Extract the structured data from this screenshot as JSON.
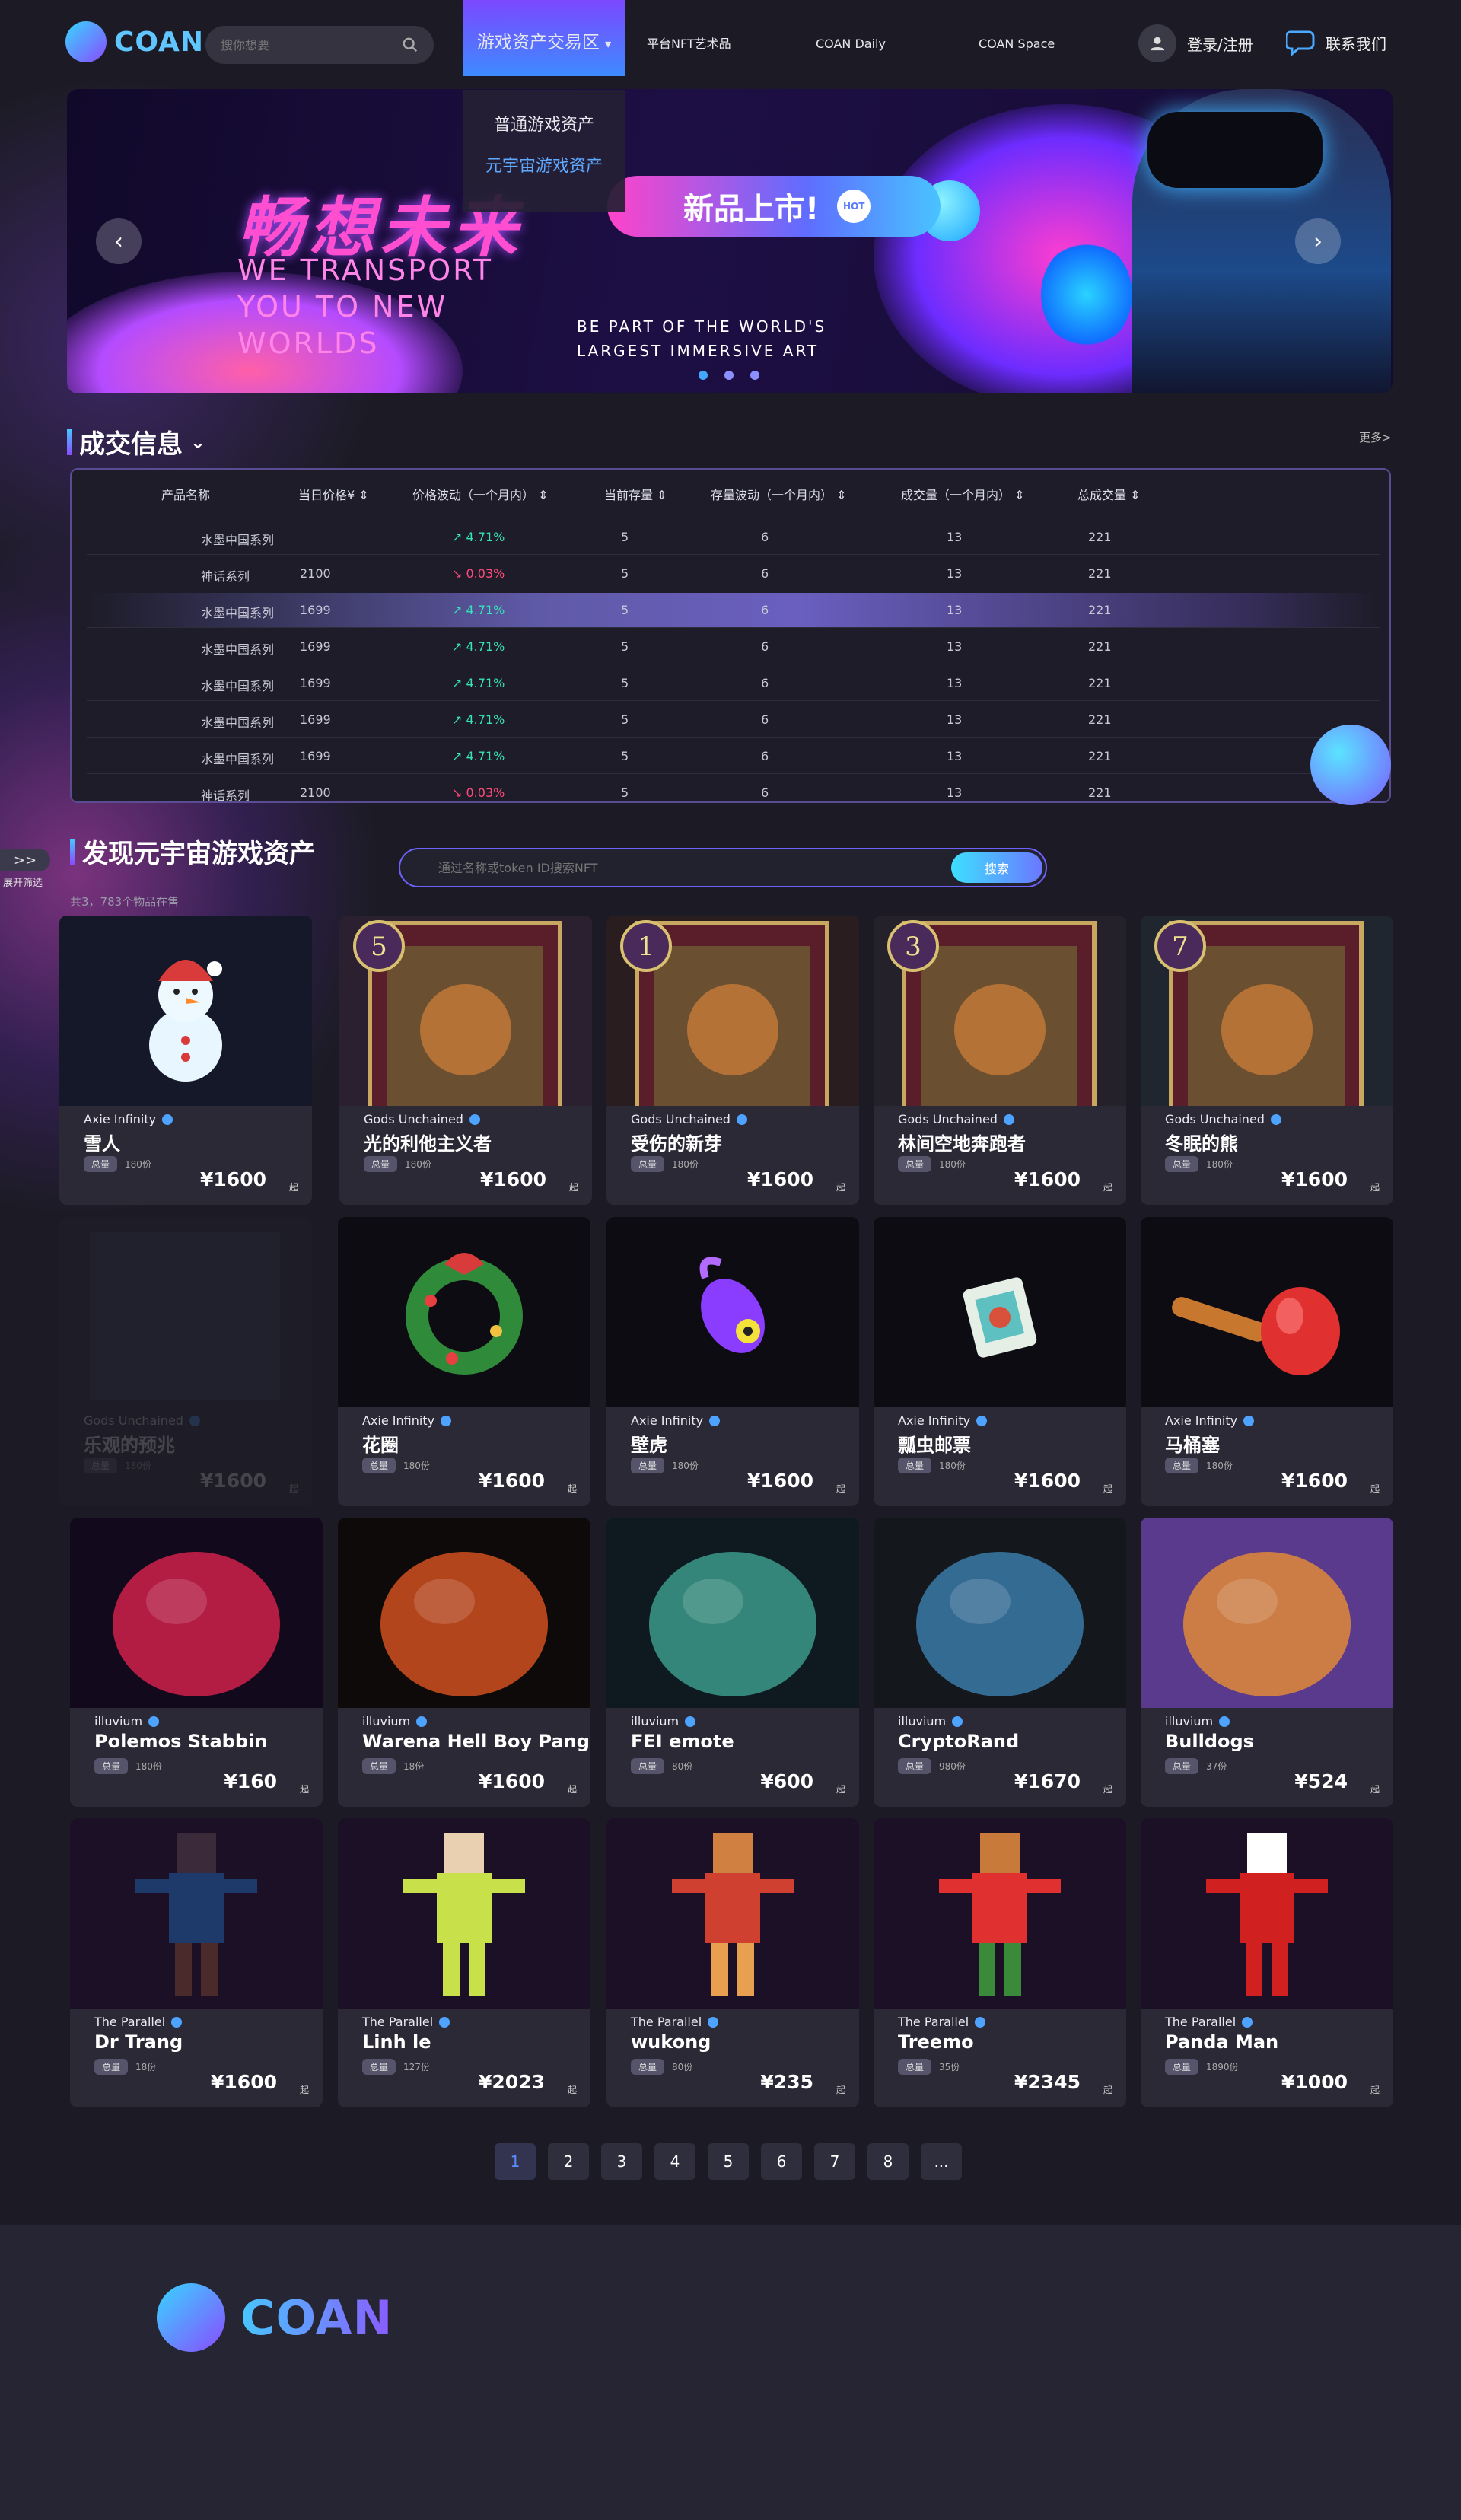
{
  "header": {
    "logo_text": "COAN",
    "search_placeholder": "搜你想要",
    "nav": [
      "游戏资产交易区",
      "平台NFT艺术品",
      "COAN Daily",
      "COAN Space"
    ],
    "dropdown": [
      "普通游戏资产",
      "元宇宙游戏资产"
    ],
    "login_label": "登录/注册",
    "contact_label": "联系我们"
  },
  "banner": {
    "title": "畅想未来",
    "pill": "新品上市!",
    "hot": "HOT",
    "en_lines": [
      "WE TRANSPORT",
      "YOU TO NEW",
      "WORLDS"
    ],
    "sub_lines": [
      "BE PART OF THE WORLD'S",
      "LARGEST IMMERSIVE ART"
    ]
  },
  "trade": {
    "title": "成交信息",
    "more": "更多>",
    "columns": [
      "产品名称",
      "当日价格¥",
      "价格波动（一个月内）",
      "当前存量",
      "存量波动（一个月内）",
      "成交量（一个月内）",
      "总成交量"
    ],
    "rows": [
      {
        "name": "水墨中国系列",
        "price": "",
        "change": "4.71%",
        "dir": "up",
        "stock": "5",
        "stock_change": "6",
        "volume": "13",
        "total": "221"
      },
      {
        "name": "神话系列",
        "price": "2100",
        "change": "0.03%",
        "dir": "down",
        "stock": "5",
        "stock_change": "6",
        "volume": "13",
        "total": "221"
      },
      {
        "name": "水墨中国系列",
        "price": "1699",
        "change": "4.71%",
        "dir": "up",
        "stock": "5",
        "stock_change": "6",
        "volume": "13",
        "total": "221"
      },
      {
        "name": "水墨中国系列",
        "price": "1699",
        "change": "4.71%",
        "dir": "up",
        "stock": "5",
        "stock_change": "6",
        "volume": "13",
        "total": "221"
      },
      {
        "name": "水墨中国系列",
        "price": "1699",
        "change": "4.71%",
        "dir": "up",
        "stock": "5",
        "stock_change": "6",
        "volume": "13",
        "total": "221"
      },
      {
        "name": "水墨中国系列",
        "price": "1699",
        "change": "4.71%",
        "dir": "up",
        "stock": "5",
        "stock_change": "6",
        "volume": "13",
        "total": "221"
      },
      {
        "name": "水墨中国系列",
        "price": "1699",
        "change": "4.71%",
        "dir": "up",
        "stock": "5",
        "stock_change": "6",
        "volume": "13",
        "total": "221"
      },
      {
        "name": "神话系列",
        "price": "2100",
        "change": "0.03%",
        "dir": "down",
        "stock": "5",
        "stock_change": "6",
        "volume": "13",
        "total": "221"
      }
    ]
  },
  "side_filter": {
    "label": "展开筛选",
    "icon": ">>"
  },
  "discover": {
    "title": "发现元宇宙游戏资产",
    "count": "共3，783个物品在售",
    "search_placeholder": "通过名称或token ID搜索NFT",
    "search_button": "搜索"
  },
  "cards": [
    {
      "brand": "Axie Infinity",
      "name": "雪人",
      "tag": "总量",
      "qty": "180份",
      "price": "¥1600",
      "suffix": "起",
      "bg": "#151829",
      "art": "snowman"
    },
    {
      "brand": "Gods Unchained",
      "name": "光的利他主义者",
      "tag": "总量",
      "qty": "180份",
      "price": "¥1600",
      "suffix": "起",
      "bg": "#2b2030",
      "art": "card5"
    },
    {
      "brand": "Gods Unchained",
      "name": "受伤的新芽",
      "tag": "总量",
      "qty": "180份",
      "price": "¥1600",
      "suffix": "起",
      "bg": "#2a1d20",
      "art": "card1"
    },
    {
      "brand": "Gods Unchained",
      "name": "林间空地奔跑者",
      "tag": "总量",
      "qty": "180份",
      "price": "¥1600",
      "suffix": "起",
      "bg": "#24212a",
      "art": "card3"
    },
    {
      "brand": "Gods Unchained",
      "name": "冬眠的熊",
      "tag": "总量",
      "qty": "180份",
      "price": "¥1600",
      "suffix": "起",
      "bg": "#1f2630",
      "art": "card7"
    },
    {
      "brand": "Gods Unchained",
      "name": "乐观的预兆",
      "tag": "总量",
      "qty": "180份",
      "price": "¥1600",
      "suffix": "起",
      "bg": "#2a2935",
      "art": "faded"
    },
    {
      "brand": "Axie Infinity",
      "name": "花圈",
      "tag": "总量",
      "qty": "180份",
      "price": "¥1600",
      "suffix": "起",
      "bg": "#0d0c12",
      "art": "wreath"
    },
    {
      "brand": "Axie Infinity",
      "name": "壁虎",
      "tag": "总量",
      "qty": "180份",
      "price": "¥1600",
      "suffix": "起",
      "bg": "#0d0c12",
      "art": "gecko"
    },
    {
      "brand": "Axie Infinity",
      "name": "瓢虫邮票",
      "tag": "总量",
      "qty": "180份",
      "price": "¥1600",
      "suffix": "起",
      "bg": "#0d0c12",
      "art": "stamp"
    },
    {
      "brand": "Axie Infinity",
      "name": "马桶塞",
      "tag": "总量",
      "qty": "180份",
      "price": "¥1600",
      "suffix": "起",
      "bg": "#0d0c12",
      "art": "plunger"
    },
    {
      "brand": "illuvium",
      "name": "Polemos Stabbin",
      "tag": "总量",
      "qty": "180份",
      "price": "¥160",
      "suffix": "起",
      "bg": "#120a1c",
      "art": "red"
    },
    {
      "brand": "illuvium",
      "name": "Warena Hell Boy Pangolin",
      "tag": "总量",
      "qty": "18份",
      "price": "¥1600",
      "suffix": "起",
      "bg": "#0e0a0a",
      "art": "fire"
    },
    {
      "brand": "illuvium",
      "name": "FEI emote",
      "tag": "总量",
      "qty": "80份",
      "price": "¥600",
      "suffix": "起",
      "bg": "#0f1a20",
      "art": "fei"
    },
    {
      "brand": "illuvium",
      "name": "CryptoRand",
      "tag": "总量",
      "qty": "980份",
      "price": "¥1670",
      "suffix": "起",
      "bg": "#14181c",
      "art": "crypto"
    },
    {
      "brand": "illuvium",
      "name": "Bulldogs",
      "tag": "总量",
      "qty": "37份",
      "price": "¥524",
      "suffix": "起",
      "bg": "#5a3a8c",
      "art": "bulldog"
    },
    {
      "brand": "The Parallel",
      "name": "Dr Trang",
      "tag": "总量",
      "qty": "18份",
      "price": "¥1600",
      "suffix": "起",
      "bg": "#1c1026",
      "art": "px1"
    },
    {
      "brand": "The Parallel",
      "name": "Linh le",
      "tag": "总量",
      "qty": "127份",
      "price": "¥2023",
      "suffix": "起",
      "bg": "#1c1026",
      "art": "px2"
    },
    {
      "brand": "The Parallel",
      "name": "wukong",
      "tag": "总量",
      "qty": "80份",
      "price": "¥235",
      "suffix": "起",
      "bg": "#1c1026",
      "art": "px3"
    },
    {
      "brand": "The Parallel",
      "name": "Treemo",
      "tag": "总量",
      "qty": "35份",
      "price": "¥2345",
      "suffix": "起",
      "bg": "#1c1026",
      "art": "px4"
    },
    {
      "brand": "The Parallel",
      "name": "Panda Man",
      "tag": "总量",
      "qty": "1890份",
      "price": "¥1000",
      "suffix": "起",
      "bg": "#1c1026",
      "art": "px5"
    }
  ],
  "pagination": [
    "1",
    "2",
    "3",
    "4",
    "5",
    "6",
    "7",
    "8",
    "..."
  ],
  "footer": {
    "logo_text": "COAN"
  }
}
